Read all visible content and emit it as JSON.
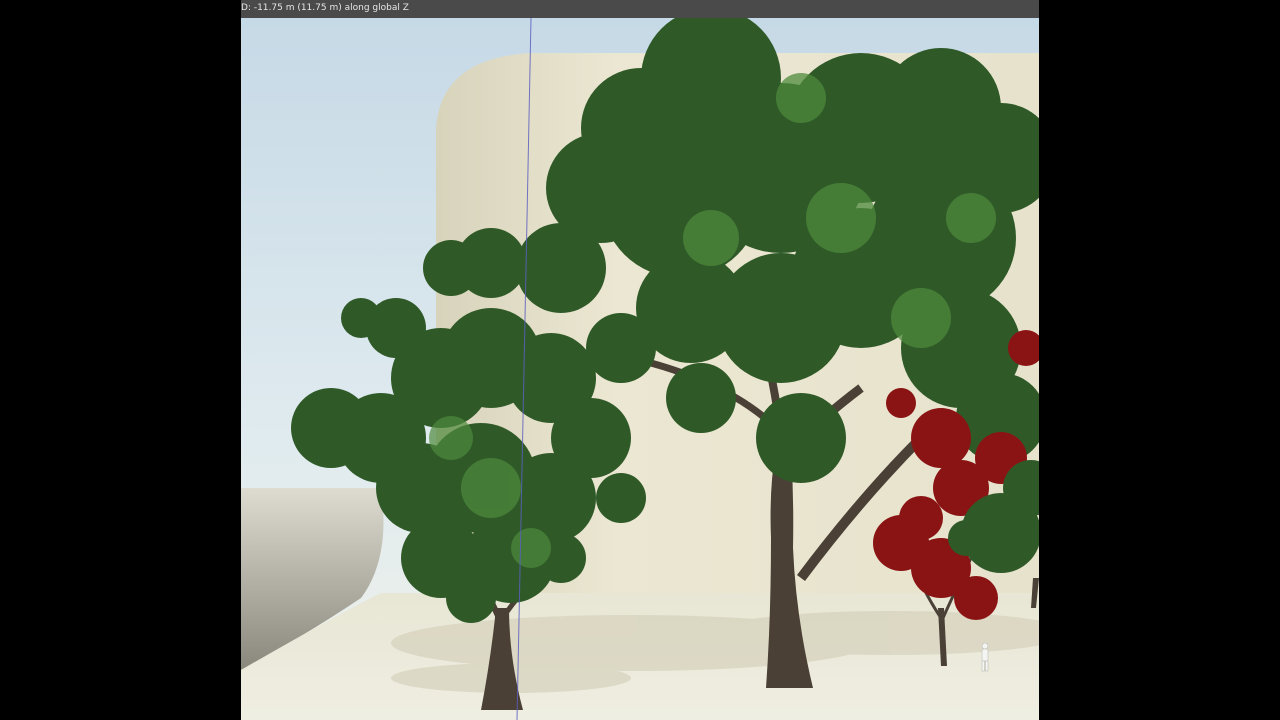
{
  "viewport": {
    "status_text": "D: -11.75 m (11.75 m) along global Z"
  },
  "scene": {
    "objects": [
      "sky",
      "curved-wall",
      "ground-plane",
      "tree-left",
      "tree-center",
      "tree-red",
      "human-figure",
      "transform-axis-line"
    ]
  },
  "colors": {
    "header_bar": "#4a4a4a",
    "sky": "#cfe0ea",
    "wall": "#e4e0cb",
    "ground": "#e9e7d8",
    "foliage": "#2f5a28",
    "foliage_light": "#4e8a3c",
    "trunk": "#4a4036",
    "red_foliage": "#8a1414",
    "axis_line": "#5a5fbf"
  }
}
